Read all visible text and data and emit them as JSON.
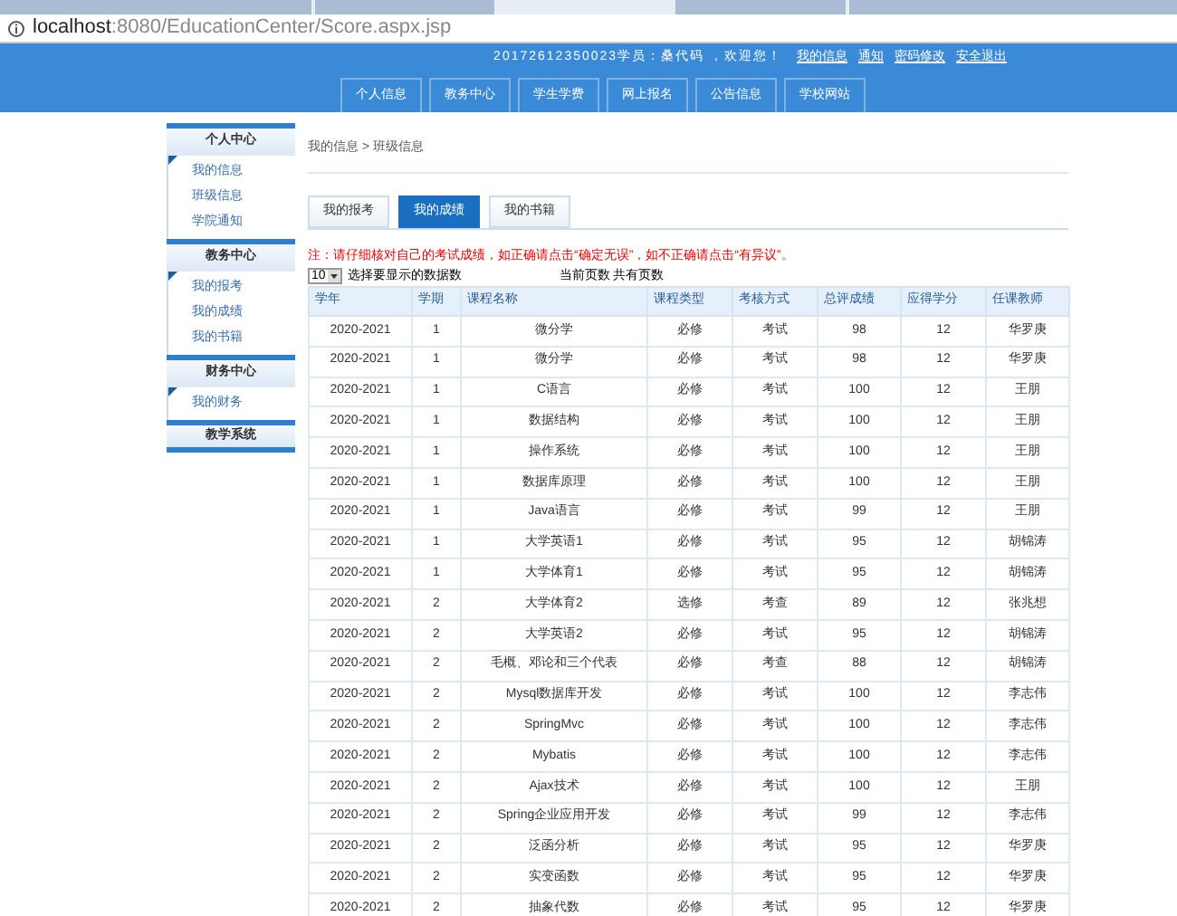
{
  "address_bar": {
    "url_host": "localhost",
    "url_rest": ":8080/EducationCenter/Score.aspx.jsp"
  },
  "header": {
    "welcome": "20172612350023学员：桑代码 ，欢迎您！",
    "links": [
      "我的信息",
      "通知",
      "密码修改",
      "安全退出"
    ],
    "nav": [
      "个人信息",
      "教务中心",
      "学生学费",
      "网上报名",
      "公告信息",
      "学校网站"
    ]
  },
  "sidebar": [
    {
      "title": "个人中心",
      "items": [
        "我的信息",
        "班级信息",
        "学院通知"
      ]
    },
    {
      "title": "教务中心",
      "items": [
        "我的报考",
        "我的成绩",
        "我的书籍"
      ]
    },
    {
      "title": "财务中心",
      "items": [
        "我的财务"
      ]
    },
    {
      "title": "教学系统"
    }
  ],
  "breadcrumb": "我的信息 > 班级信息",
  "tabs": [
    {
      "label": "我的报考",
      "selected": false
    },
    {
      "label": "我的成绩",
      "selected": true
    },
    {
      "label": "我的书籍",
      "selected": false
    }
  ],
  "notice": "注：请仔细核对自己的考试成绩，如正确请点击“确定无误”，如不正确请点击“有异议”。",
  "page_size": {
    "value": "10",
    "label": "选择要显示的数据数",
    "page_info": "当前页数 共有页数"
  },
  "table": {
    "columns": [
      "学年",
      "学期",
      "课程名称",
      "课程类型",
      "考核方式",
      "总评成绩",
      "应得学分",
      "任课教师"
    ],
    "rows": [
      [
        "2020-2021",
        "1",
        "微分学",
        "必修",
        "考试",
        "98",
        "12",
        "华罗庚"
      ],
      [
        "2020-2021",
        "1",
        "微分学",
        "必修",
        "考试",
        "98",
        "12",
        "华罗庚"
      ],
      [
        "2020-2021",
        "1",
        "C语言",
        "必修",
        "考试",
        "100",
        "12",
        "王朋"
      ],
      [
        "2020-2021",
        "1",
        "数据结构",
        "必修",
        "考试",
        "100",
        "12",
        "王朋"
      ],
      [
        "2020-2021",
        "1",
        "操作系统",
        "必修",
        "考试",
        "100",
        "12",
        "王朋"
      ],
      [
        "2020-2021",
        "1",
        "数据库原理",
        "必修",
        "考试",
        "100",
        "12",
        "王朋"
      ],
      [
        "2020-2021",
        "1",
        "Java语言",
        "必修",
        "考试",
        "99",
        "12",
        "王朋"
      ],
      [
        "2020-2021",
        "1",
        "大学英语1",
        "必修",
        "考试",
        "95",
        "12",
        "胡锦涛"
      ],
      [
        "2020-2021",
        "1",
        "大学体育1",
        "必修",
        "考试",
        "95",
        "12",
        "胡锦涛"
      ],
      [
        "2020-2021",
        "2",
        "大学体育2",
        "选修",
        "考查",
        "89",
        "12",
        "张兆想"
      ],
      [
        "2020-2021",
        "2",
        "大学英语2",
        "必修",
        "考试",
        "95",
        "12",
        "胡锦涛"
      ],
      [
        "2020-2021",
        "2",
        "毛概、邓论和三个代表",
        "必修",
        "考查",
        "88",
        "12",
        "胡锦涛"
      ],
      [
        "2020-2021",
        "2",
        "Mysql数据库开发",
        "必修",
        "考试",
        "100",
        "12",
        "李志伟"
      ],
      [
        "2020-2021",
        "2",
        "SpringMvc",
        "必修",
        "考试",
        "100",
        "12",
        "李志伟"
      ],
      [
        "2020-2021",
        "2",
        "Mybatis",
        "必修",
        "考试",
        "100",
        "12",
        "李志伟"
      ],
      [
        "2020-2021",
        "2",
        "Ajax技术",
        "必修",
        "考试",
        "100",
        "12",
        "王朋"
      ],
      [
        "2020-2021",
        "2",
        "Spring企业应用开发",
        "必修",
        "考试",
        "99",
        "12",
        "李志伟"
      ],
      [
        "2020-2021",
        "2",
        "泛函分析",
        "必修",
        "考试",
        "95",
        "12",
        "华罗庚"
      ],
      [
        "2020-2021",
        "2",
        "实变函数",
        "必修",
        "考试",
        "95",
        "12",
        "华罗庚"
      ],
      [
        "2020-2021",
        "2",
        "抽象代数",
        "必修",
        "考试",
        "95",
        "12",
        "华罗庚"
      ]
    ]
  }
}
